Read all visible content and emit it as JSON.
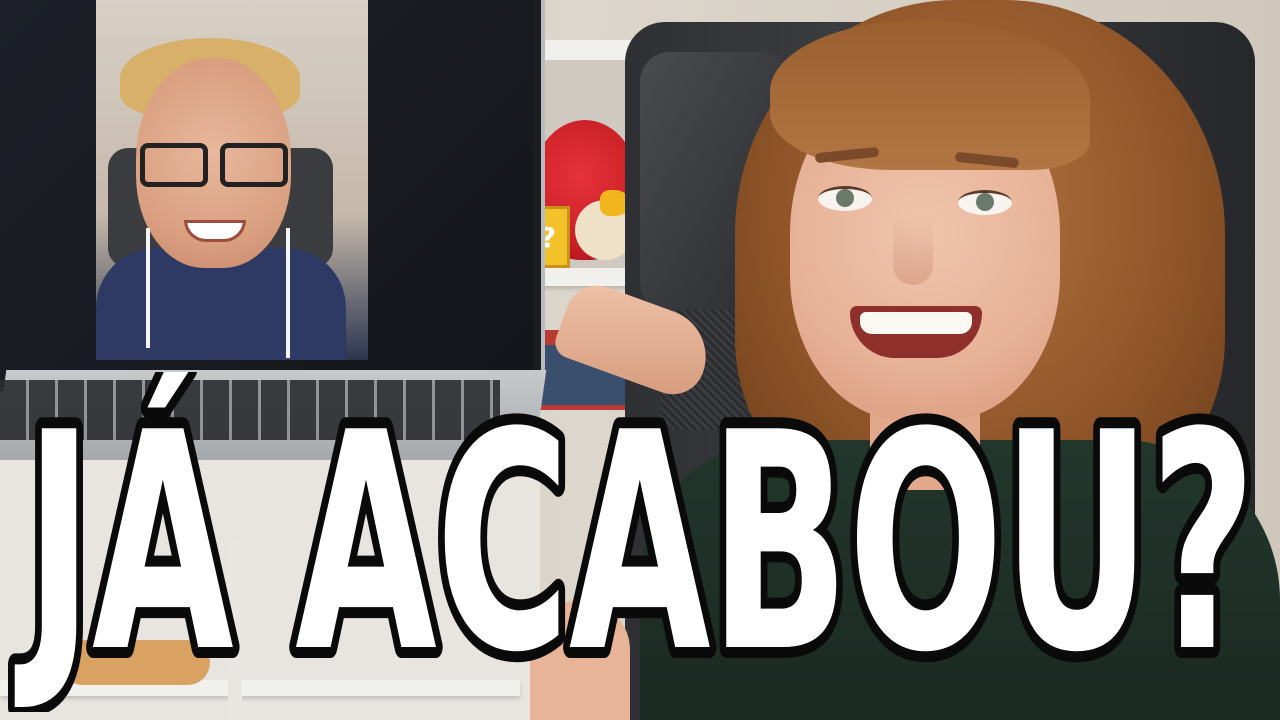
{
  "headline": {
    "text": "JÁ ACABOU?",
    "fill_color": "#ffffff",
    "stroke_color": "#0a0a0a"
  },
  "props": {
    "question_block_glyph": "?"
  },
  "colors": {
    "wall": "#d9d2c7",
    "sweater": "#1f3128",
    "hair": "#a0602f",
    "chair": "#333438"
  }
}
